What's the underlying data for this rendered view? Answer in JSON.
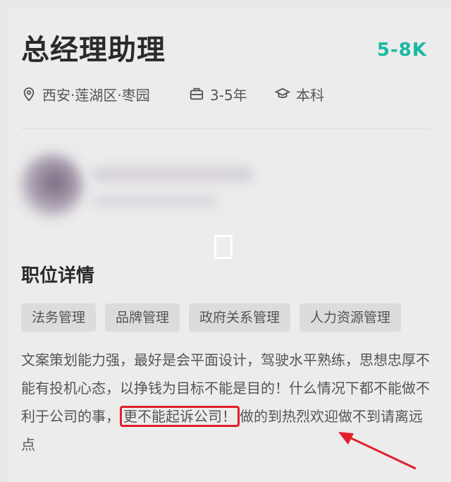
{
  "job": {
    "title": "总经理助理",
    "salary": "5-8K",
    "location": "西安·莲湖区·枣园",
    "experience": "3-5年",
    "education": "本科"
  },
  "section": {
    "title": "职位详情"
  },
  "tags": [
    "法务管理",
    "品牌管理",
    "政府关系管理",
    "人力资源管理"
  ],
  "description": {
    "before": "文案策划能力强，最好是会平面设计，驾驶水平熟练，思想忠厚不能有投机心态，以挣钱为目标不能是目的！什么情况下都不能做不利于公司的事，",
    "highlight": "更不能起诉公司！",
    "after": "做的到热烈欢迎做不到请离远点"
  },
  "colors": {
    "salary": "#19b8a3",
    "highlight_box": "#e21f2a",
    "arrow": "#e21f2a"
  },
  "icons": [
    "location-pin-icon",
    "briefcase-icon",
    "graduation-cap-icon"
  ]
}
